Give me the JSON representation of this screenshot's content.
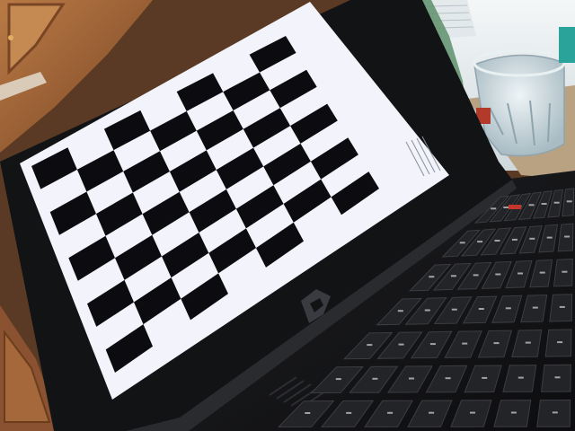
{
  "scene": {
    "description_visible_text": "",
    "checkerboard": {
      "rows": 9,
      "cols": 7
    },
    "colors": {
      "cabinet_wood": "#a4683a",
      "cabinet_dark": "#6b3d1c",
      "window_light": "#e8eef0",
      "laptop_bezel": "#121314",
      "laptop_body": "#1a1b1d",
      "screen_white": "#f2f3fb",
      "checker_black": "#0c0c10",
      "keyboard_key": "#232428",
      "key_legend": "#d8d8d8",
      "glass_tint": "#cfdde3",
      "countertop": "#b9a282"
    },
    "icons": {
      "laptop_logo": "rog-logo-icon",
      "glass": "drinking-glass-icon",
      "bottle": "green-bottle-icon"
    }
  }
}
